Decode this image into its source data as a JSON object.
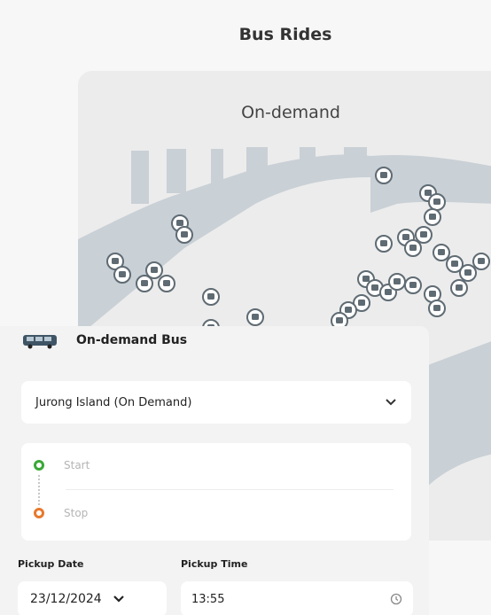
{
  "header": {
    "title": "Bus Rides"
  },
  "map": {
    "title": "On-demand",
    "stop_icon": "bus-stop-pin-icon",
    "water_color": "#c9d0d6",
    "land_color": "#ececec"
  },
  "panel": {
    "title": "On-demand Bus",
    "route": {
      "value": "Jurong Island (On Demand)"
    },
    "stops": {
      "start_placeholder": "Start",
      "end_placeholder": "Stop"
    },
    "pickup_date": {
      "label": "Pickup Date",
      "value": "23/12/2024"
    },
    "pickup_time": {
      "label": "Pickup Time",
      "value": "13:55"
    }
  },
  "colors": {
    "start": "#3aa837",
    "end": "#e8782c"
  }
}
